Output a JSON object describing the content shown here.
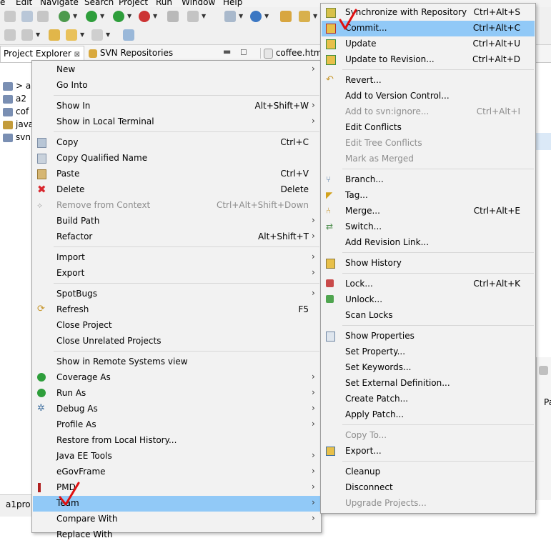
{
  "menubar": [
    "e",
    "Edit",
    "Navigate",
    "Search",
    "Project",
    "Run",
    "Window",
    "Help"
  ],
  "view_tabs": {
    "project_explorer": "Project Explorer",
    "svn_repositories": "SVN Repositories",
    "editor_tab": "coffee.html"
  },
  "tree": [
    "> a",
    "a2",
    "cof",
    "java",
    "svn"
  ],
  "status": {
    "project": "a1pro"
  },
  "right_panel_label": "Pa",
  "context_menu": {
    "new": "New",
    "go_into": "Go Into",
    "show_in": {
      "label": "Show In",
      "shortcut": "Alt+Shift+W"
    },
    "show_in_terminal": "Show in Local Terminal",
    "copy": {
      "label": "Copy",
      "shortcut": "Ctrl+C"
    },
    "copy_qualified": "Copy Qualified Name",
    "paste": {
      "label": "Paste",
      "shortcut": "Ctrl+V"
    },
    "delete": {
      "label": "Delete",
      "shortcut": "Delete"
    },
    "remove_context": {
      "label": "Remove from Context",
      "shortcut": "Ctrl+Alt+Shift+Down"
    },
    "build_path": "Build Path",
    "refactor": {
      "label": "Refactor",
      "shortcut": "Alt+Shift+T"
    },
    "import": "Import",
    "export": "Export",
    "spotbugs": "SpotBugs",
    "refresh": {
      "label": "Refresh",
      "shortcut": "F5"
    },
    "close_project": "Close Project",
    "close_unrelated": "Close Unrelated Projects",
    "show_remote": "Show in Remote Systems view",
    "coverage_as": "Coverage As",
    "run_as": "Run As",
    "debug_as": "Debug As",
    "profile_as": "Profile As",
    "restore_history": "Restore from Local History...",
    "javaee_tools": "Java EE Tools",
    "egovframe": "eGovFrame",
    "pmd": "PMD",
    "team": "Team",
    "compare_with": "Compare With",
    "replace_with": "Replace With"
  },
  "team_menu": {
    "synchronize": {
      "label": "Synchronize with Repository",
      "shortcut": "Ctrl+Alt+S"
    },
    "commit": {
      "label": "Commit...",
      "shortcut": "Ctrl+Alt+C"
    },
    "update": {
      "label": "Update",
      "shortcut": "Ctrl+Alt+U"
    },
    "update_revision": {
      "label": "Update to Revision...",
      "shortcut": "Ctrl+Alt+D"
    },
    "revert": "Revert...",
    "add_vc": "Add to Version Control...",
    "add_ignore": {
      "label": "Add to svn:ignore...",
      "shortcut": "Ctrl+Alt+I"
    },
    "edit_conflicts": "Edit Conflicts",
    "edit_tree_conflicts": "Edit Tree Conflicts",
    "mark_merged": "Mark as Merged",
    "branch": "Branch...",
    "tag": "Tag...",
    "merge": {
      "label": "Merge...",
      "shortcut": "Ctrl+Alt+E"
    },
    "switch": "Switch...",
    "add_revision_link": "Add Revision Link...",
    "show_history": "Show History",
    "lock": {
      "label": "Lock...",
      "shortcut": "Ctrl+Alt+K"
    },
    "unlock": "Unlock...",
    "scan_locks": "Scan Locks",
    "show_properties": "Show Properties",
    "set_property": "Set Property...",
    "set_keywords": "Set Keywords...",
    "set_external": "Set External Definition...",
    "create_patch": "Create Patch...",
    "apply_patch": "Apply Patch...",
    "copy_to": "Copy To...",
    "export": "Export...",
    "cleanup": "Cleanup",
    "disconnect": "Disconnect",
    "upgrade_projects": "Upgrade Projects..."
  },
  "colors": {
    "highlight": "#91c9f7",
    "menu_bg": "#f2f2f2",
    "annotation": "#e01010"
  }
}
